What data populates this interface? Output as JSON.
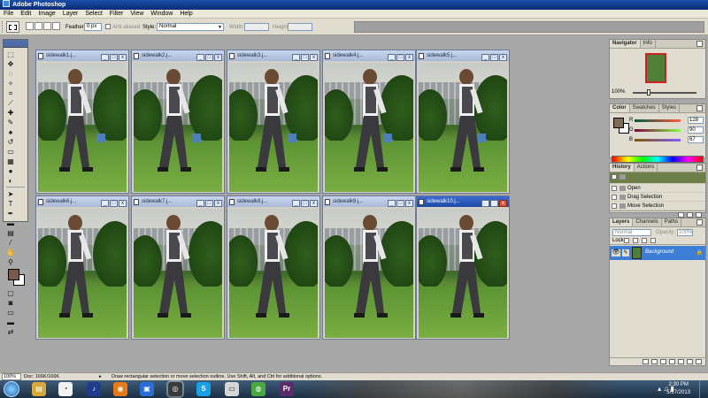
{
  "app": {
    "title": "Adobe Photoshop"
  },
  "menu": [
    "File",
    "Edit",
    "Image",
    "Layer",
    "Select",
    "Filter",
    "View",
    "Window",
    "Help"
  ],
  "options": {
    "feather_label": "Feather:",
    "feather_value": "0 px",
    "antialiased_label": "Anti-aliased",
    "style_label": "Style:",
    "style_value": "Normal",
    "width_label": "Width:",
    "height_label": "Height:"
  },
  "documents": [
    {
      "title": "sidewalk1.j...",
      "active": false
    },
    {
      "title": "sidewalk2.j...",
      "active": false
    },
    {
      "title": "sidewalk3.j...",
      "active": false
    },
    {
      "title": "sidewalk4.j...",
      "active": false
    },
    {
      "title": "sidewalk5.j...",
      "active": false
    },
    {
      "title": "sidewalk6.j...",
      "active": false
    },
    {
      "title": "sidewalk7.j...",
      "active": false
    },
    {
      "title": "sidewalk8.j...",
      "active": false
    },
    {
      "title": "sidewalk9.j...",
      "active": false
    },
    {
      "title": "sidewalk10.j...",
      "active": true
    }
  ],
  "navigator": {
    "tabs": [
      "Navigator",
      "Info"
    ],
    "zoom": "100%"
  },
  "color": {
    "tabs": [
      "Color",
      "Swatches",
      "Styles"
    ],
    "fg_hex": "#80 5A 43",
    "r_label": "R",
    "r_value": "128",
    "g_label": "G",
    "g_value": "90",
    "b_label": "B",
    "b_value": "67"
  },
  "history": {
    "tabs": [
      "History",
      "Actions"
    ],
    "items": [
      "Open",
      "Drag Selection",
      "Move Selection"
    ]
  },
  "layers": {
    "tabs": [
      "Layers",
      "Channels",
      "Paths"
    ],
    "blend_mode": "Normal",
    "opacity_label": "Opacity:",
    "opacity_value": "100%",
    "lock_label": "Lock:",
    "layer_name": "Background"
  },
  "status": {
    "zoom": "100%",
    "doc": "Doc: 166K/166K",
    "tip": "Draw rectangular selection or move selection outline.  Use Shift, Alt, and Ctrl for additional options."
  },
  "taskbar": {
    "time": "2:30 PM",
    "date": "5/17/2013"
  }
}
